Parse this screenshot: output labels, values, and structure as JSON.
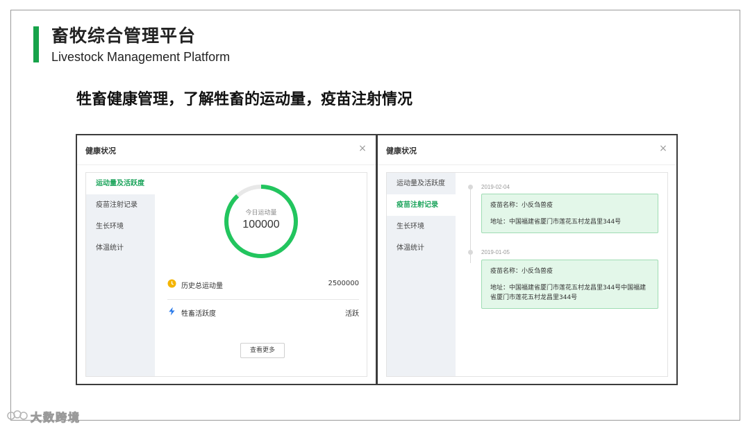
{
  "slide": {
    "title_cn": "畜牧综合管理平台",
    "title_en": "Livestock Management Platform",
    "subtitle": "牲畜健康管理，了解牲畜的运动量，疫苗注射情况",
    "watermark": "大数跨境"
  },
  "left_panel": {
    "title": "健康状况",
    "close": "×",
    "nav": [
      {
        "label": "运动量及活跃度",
        "active": true
      },
      {
        "label": "疫苗注射记录",
        "active": false
      },
      {
        "label": "生长环境",
        "active": false
      },
      {
        "label": "体温统计",
        "active": false
      }
    ],
    "ring": {
      "label": "今日运动量",
      "value": "100000",
      "progress": 0.88,
      "color": "#22c55e"
    },
    "stats": [
      {
        "icon": "coin-icon",
        "label": "历史总运动量",
        "value": "2500000"
      },
      {
        "icon": "lightning-icon",
        "label": "牲畜活跃度",
        "value": "活跃"
      }
    ],
    "more_button": "查看更多"
  },
  "right_panel": {
    "title": "健康状况",
    "close": "×",
    "nav": [
      {
        "label": "运动量及活跃度",
        "active": false
      },
      {
        "label": "疫苗注射记录",
        "active": true
      },
      {
        "label": "生长环境",
        "active": false
      },
      {
        "label": "体温统计",
        "active": false
      }
    ],
    "records": [
      {
        "date": "2019-02-04",
        "name": "疫苗名称：小反刍兽疫",
        "address": "地址：中国福建省厦门市莲花五村龙昌里344号"
      },
      {
        "date": "2019-01-05",
        "name": "疫苗名称：小反刍兽疫",
        "address": "地址：中国福建省厦门市莲花五村龙昌里344号中国福建省厦门市莲花五村龙昌里344号"
      }
    ]
  },
  "colors": {
    "accent": "#17a34a",
    "active_nav": "#1aa35a",
    "card_bg": "#e3f7e9",
    "card_border": "#9edcb3"
  }
}
